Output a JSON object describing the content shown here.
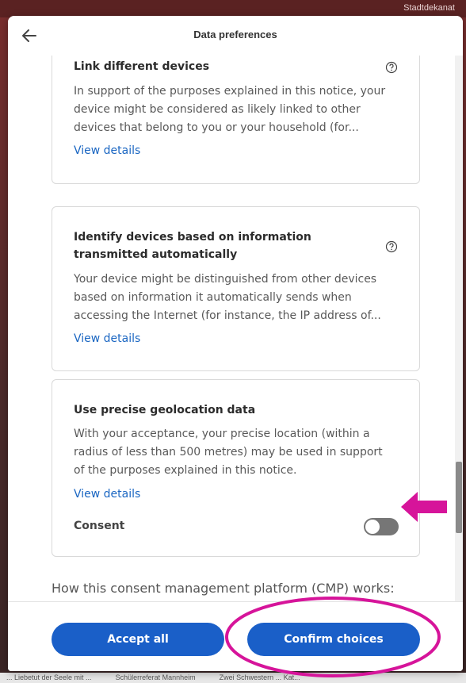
{
  "background": {
    "header_text": "Stadtdekanat",
    "footer_items": [
      "... Liebetut der Seele mit ...",
      "Schülerreferat Mannheim",
      "Zwei Schwestern ... Kat..."
    ]
  },
  "modal": {
    "title": "Data preferences",
    "back_icon": "arrow-left-icon",
    "cards": [
      {
        "title_lines": [
          "Link different devices"
        ],
        "desc_lines": [
          "In support of the purposes explained in this notice, your",
          "device might be considered as likely linked to other",
          "devices that belong to you or your household (for..."
        ],
        "link": "View details",
        "has_help": true
      },
      {
        "title_lines": [
          "Identify devices based on information",
          "transmitted automatically"
        ],
        "desc_lines": [
          "Your device might be distinguished from other devices",
          "based on information it automatically sends when",
          "accessing the Internet (for instance, the IP address of..."
        ],
        "link": "View details",
        "has_help": true
      },
      {
        "title_lines": [
          "Use precise geolocation data"
        ],
        "desc_lines": [
          "With your acceptance, your precise location (within a",
          "radius of less than 500 metres) may be used in support",
          "of the purposes explained in this notice."
        ],
        "link": "View details",
        "consent_label": "Consent",
        "consent_on": false
      }
    ],
    "cmp_heading": "How this consent management platform (CMP) works:",
    "buttons": {
      "accept_all": "Accept all",
      "confirm_choices": "Confirm choices"
    }
  },
  "colors": {
    "primary": "#1a5fc8",
    "link": "#1a66c2",
    "annotation": "#d6149a"
  }
}
